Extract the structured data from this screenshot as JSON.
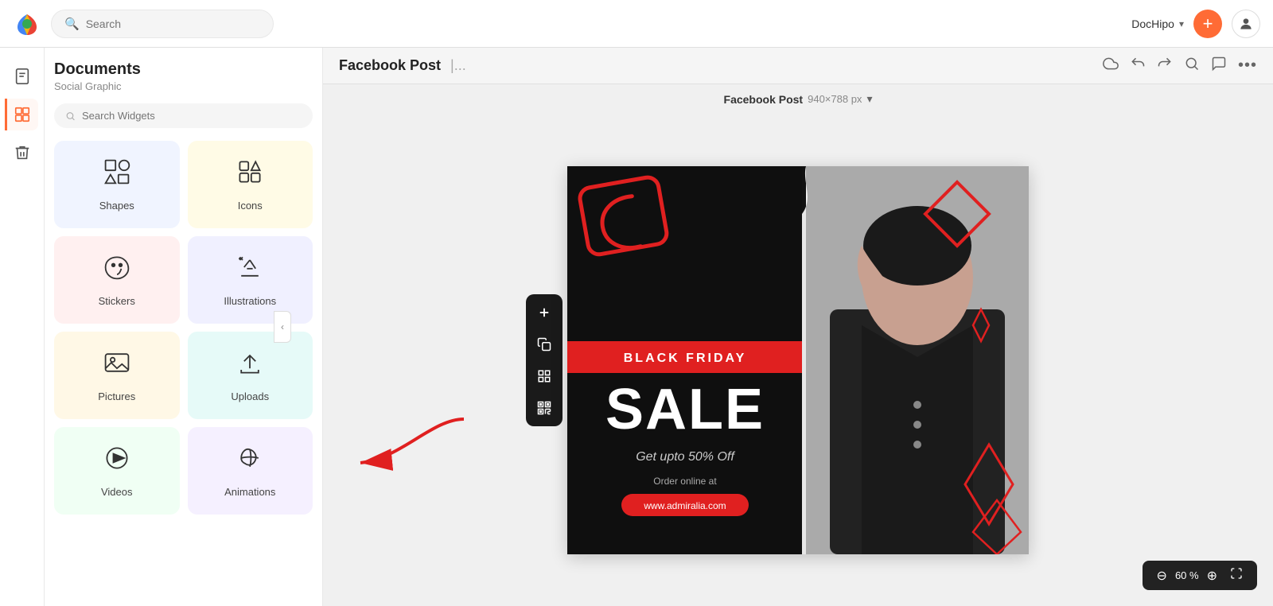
{
  "app": {
    "logo_colors": [
      "#ea4335",
      "#fbbc05",
      "#34a853",
      "#4285f4"
    ],
    "title": "DocHipo"
  },
  "topnav": {
    "search_placeholder": "Search",
    "dochipo_label": "DocHipo",
    "plus_button": "+",
    "search_icon": "🔍"
  },
  "leftnav": {
    "items": [
      {
        "id": "document",
        "icon": "📄",
        "label": "Document"
      },
      {
        "id": "widget",
        "icon": "🖼",
        "label": "Widget",
        "active": true
      },
      {
        "id": "trash",
        "icon": "🗑",
        "label": "Trash"
      }
    ]
  },
  "sidebar": {
    "title": "Documents",
    "subtitle": "Social Graphic",
    "search_placeholder": "Search Widgets",
    "widgets": [
      {
        "id": "shapes",
        "label": "Shapes",
        "icon": "shapes",
        "color_class": "card-shapes"
      },
      {
        "id": "icons",
        "label": "Icons",
        "icon": "icons",
        "color_class": "card-icons"
      },
      {
        "id": "stickers",
        "label": "Stickers",
        "icon": "stickers",
        "color_class": "card-stickers"
      },
      {
        "id": "illustrations",
        "label": "Illustrations",
        "icon": "illustrations",
        "color_class": "card-illustrations"
      },
      {
        "id": "pictures",
        "label": "Pictures",
        "icon": "pictures",
        "color_class": "card-pictures"
      },
      {
        "id": "uploads",
        "label": "Uploads",
        "icon": "uploads",
        "color_class": "card-uploads"
      },
      {
        "id": "videos",
        "label": "Videos",
        "icon": "videos",
        "color_class": "card-videos"
      },
      {
        "id": "animations",
        "label": "Animations",
        "icon": "animations",
        "color_class": "card-animations"
      }
    ]
  },
  "editor": {
    "doc_title": "Facebook Post",
    "doc_title_sep": "|...",
    "canvas_label": "Facebook Post",
    "canvas_dimensions": "940×788 px",
    "topbar_icons": [
      "cloud",
      "undo",
      "redo",
      "search",
      "comment",
      "more"
    ]
  },
  "canvas": {
    "black_friday_label": "BLACK FRIDAY",
    "sale_label": "SALE",
    "subtitle": "Get upto 50% Off",
    "order_label": "Order online at",
    "url": "www.admiralia.com",
    "accent_color": "#e02020"
  },
  "toolbar": {
    "buttons": [
      "plus",
      "copy",
      "grid",
      "qr"
    ],
    "float_tooltips": [
      "Add",
      "Copy",
      "Grid",
      "QR"
    ]
  },
  "zoom": {
    "value": "60 %",
    "minus": "⊖",
    "plus": "⊕",
    "fullscreen": "⛶"
  }
}
